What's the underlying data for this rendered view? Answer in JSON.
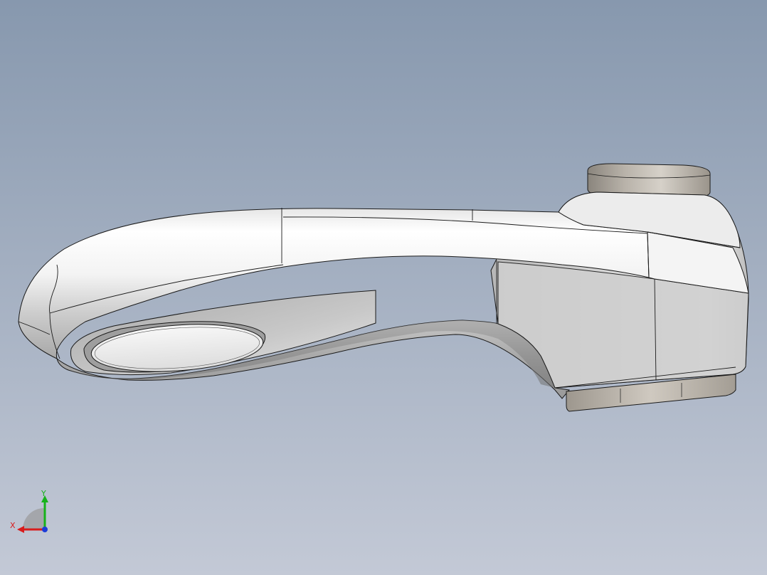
{
  "viewport": {
    "background_top": "#8798ae",
    "background_bottom": "#c3c9d6"
  },
  "model": {
    "body_color": "#f2f2f2",
    "shadow_color": "#8e8e8e",
    "edge_color": "#1a1a1a",
    "metal_color": "#b3ada4"
  },
  "triad": {
    "y_label": "Y",
    "x_label": "X",
    "y_color": "#16b21a",
    "x_color": "#d81c1c",
    "z_color": "#1c3cd8"
  }
}
